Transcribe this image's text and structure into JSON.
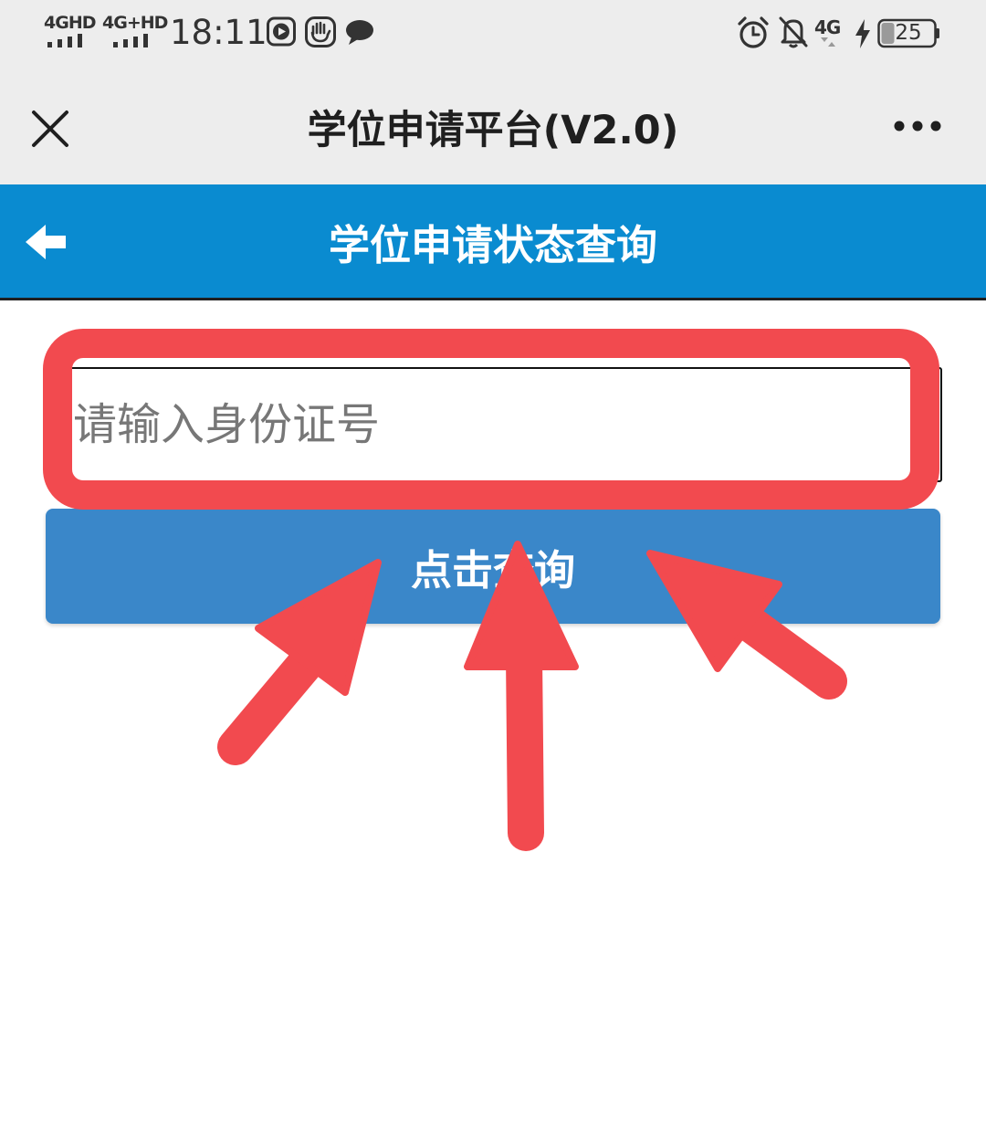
{
  "status_bar": {
    "sim1_label": "4GHD",
    "sim2_label": "4G+HD",
    "time": "18:11",
    "mobile_data_label": "4G",
    "battery_level": "25",
    "icons": [
      "video-app-icon",
      "hand-app-icon",
      "chat-bubble-icon",
      "alarm-clock-icon",
      "bell-muted-icon",
      "charging-icon",
      "battery-icon"
    ]
  },
  "web_header": {
    "title": "学位申请平台(V2.0)",
    "icons": [
      "close-icon",
      "more-icon"
    ]
  },
  "app_bar": {
    "title": "学位申请状态查询",
    "icons": [
      "back-arrow-icon"
    ]
  },
  "form": {
    "id_input_placeholder": "请输入身份证号",
    "id_input_value": "",
    "query_button_label": "点击查询"
  },
  "annotation": {
    "color": "#f24a4f"
  },
  "colors": {
    "status_bg": "#ededed",
    "app_bar": "#0a8bd0",
    "button": "#3a87c9"
  }
}
